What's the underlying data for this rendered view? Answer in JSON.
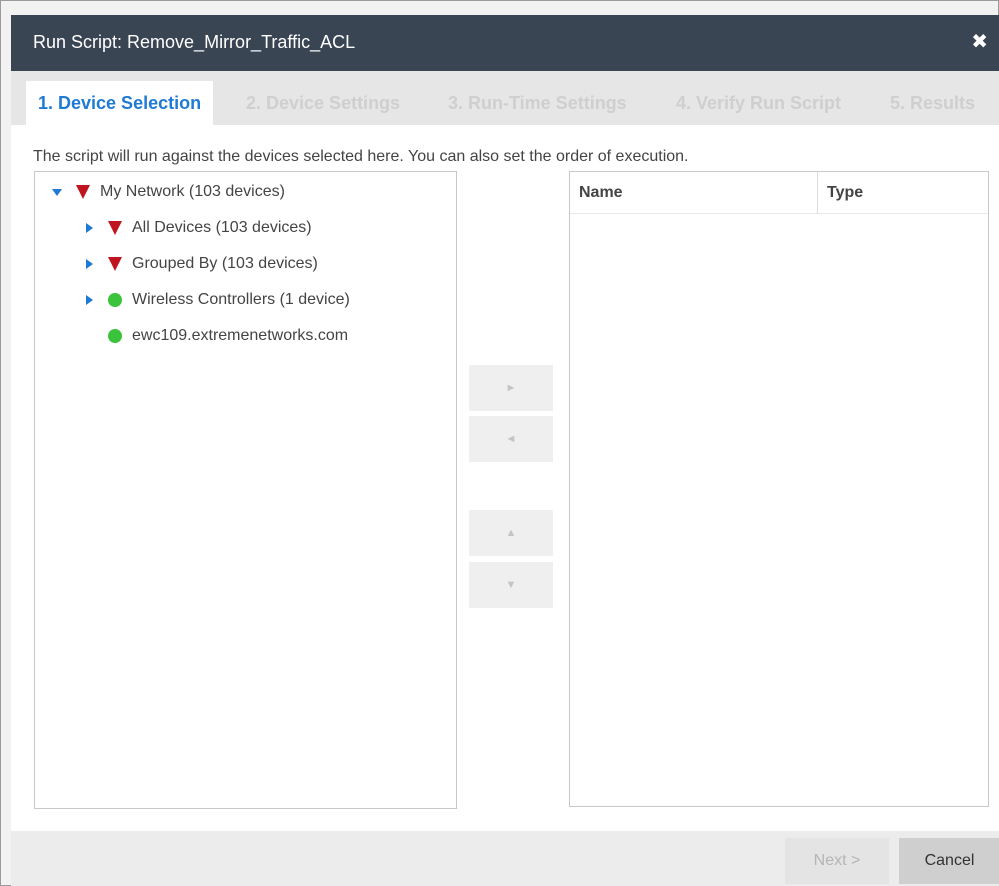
{
  "dialog": {
    "title": "Run Script: Remove_Mirror_Traffic_ACL",
    "close_icon": "close-icon",
    "close_glyph": "✖"
  },
  "tabs": [
    {
      "label": "1. Device Selection",
      "active": true
    },
    {
      "label": "2. Device Settings",
      "active": false
    },
    {
      "label": "3. Run-Time Settings",
      "active": false
    },
    {
      "label": "4. Verify Run Script",
      "active": false
    },
    {
      "label": "5. Results",
      "active": false
    }
  ],
  "instruction": "The script will run against the devices selected here. You can also set the order of execution.",
  "tree": {
    "items": [
      {
        "label": "My Network (103 devices)",
        "expander": "expanded",
        "status": "red-triangle-icon"
      },
      {
        "label": "All Devices (103 devices)",
        "expander": "collapsed",
        "status": "red-triangle-icon"
      },
      {
        "label": "Grouped By (103 devices)",
        "expander": "collapsed",
        "status": "red-triangle-icon"
      },
      {
        "label": "Wireless Controllers (1 device)",
        "expander": "collapsed",
        "status": "green-dot-icon"
      },
      {
        "label": "ewc109.extremenetworks.com",
        "expander": "none",
        "status": "green-dot-icon"
      }
    ]
  },
  "move_buttons": {
    "add": "►",
    "remove": "◄",
    "up": "▲",
    "down": "▼"
  },
  "selected_grid": {
    "columns": [
      "Name",
      "Type"
    ],
    "rows": []
  },
  "footer": {
    "next_label": "Next >",
    "cancel_label": "Cancel"
  },
  "colors": {
    "titlebar": "#3a4554",
    "active_tab_text": "#1f7ad4",
    "status_critical": "#c0141e",
    "status_ok": "#3cc33c"
  }
}
